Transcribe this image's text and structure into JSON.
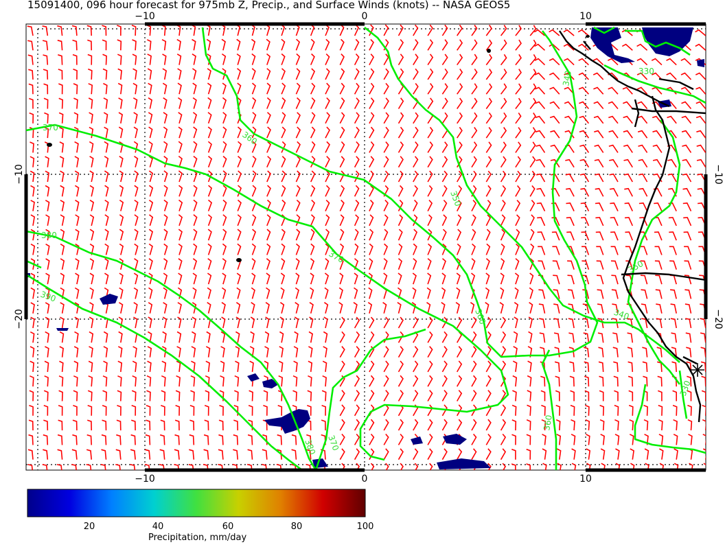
{
  "title": "15091400, 096 hour forecast for 975mb Z, Precip., and Surface Winds (knots) -- NASA GEOS5",
  "axes": {
    "lon_ticks": [
      "−10",
      "0",
      "10"
    ],
    "lat_ticks": [
      "−10",
      "−20"
    ]
  },
  "contours": [
    {
      "label": "370"
    },
    {
      "label": "360"
    },
    {
      "label": "380"
    },
    {
      "label": "390"
    },
    {
      "label": "350"
    },
    {
      "label": "370"
    },
    {
      "label": "360"
    },
    {
      "label": "380"
    },
    {
      "label": "370"
    },
    {
      "label": "360"
    },
    {
      "label": "340"
    },
    {
      "label": "340"
    },
    {
      "label": "350"
    },
    {
      "label": "330"
    },
    {
      "label": "330"
    }
  ],
  "colorbar": {
    "label": "Precipitation, mm/day",
    "ticks": [
      "20",
      "40",
      "60",
      "80",
      "100"
    ],
    "stops": [
      "#00008b",
      "#0000e0",
      "#0080ff",
      "#00d0d0",
      "#40e040",
      "#c8d000",
      "#e08000",
      "#d00000",
      "#600000"
    ]
  },
  "colors": {
    "wind_barb": "#ff0000",
    "contour": "#00ee00",
    "precip": "#000080",
    "coast": "#000000"
  }
}
